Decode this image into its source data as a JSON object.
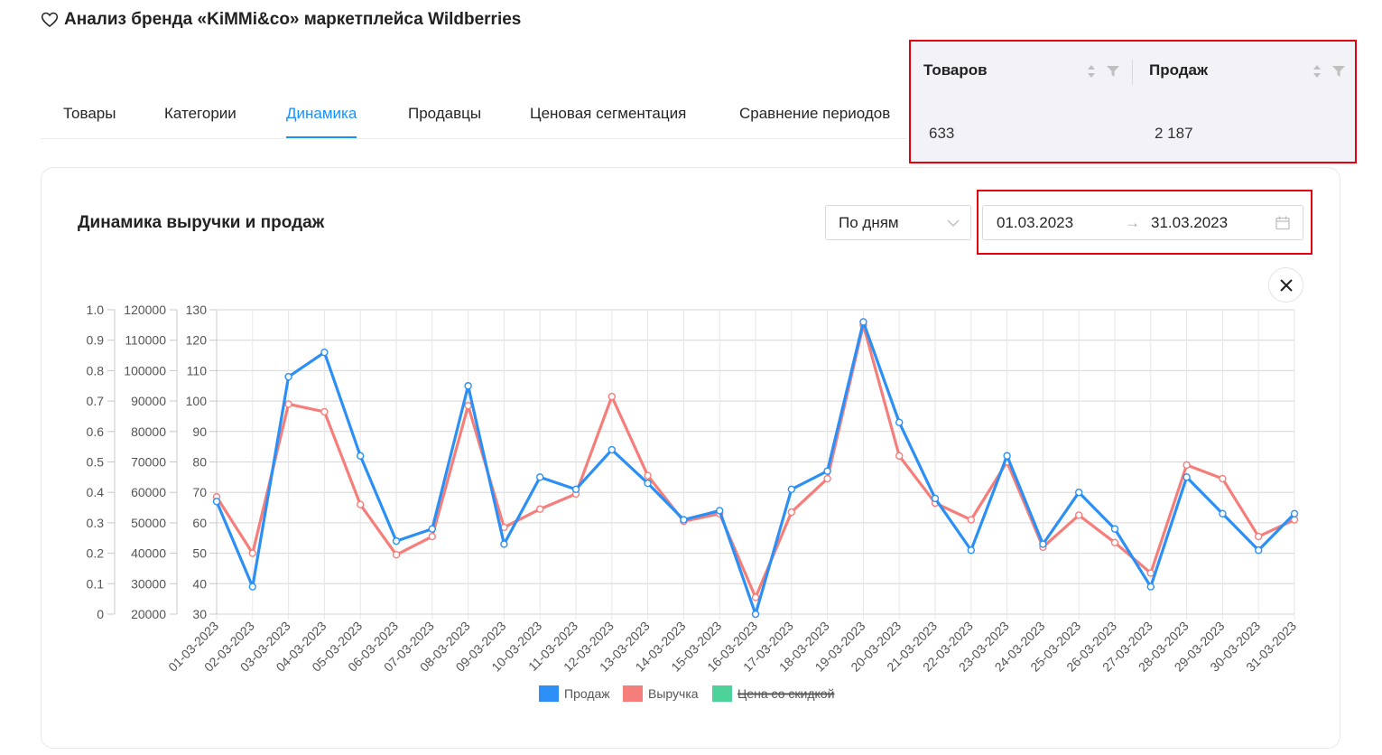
{
  "header": {
    "title": "Анализ бренда «KiMMi&co» маркетплейса Wildberries"
  },
  "tabs": [
    {
      "label": "Товары"
    },
    {
      "label": "Категории"
    },
    {
      "label": "Динамика",
      "active": true
    },
    {
      "label": "Продавцы"
    },
    {
      "label": "Ценовая сегментация"
    },
    {
      "label": "Сравнение периодов"
    }
  ],
  "stats": {
    "columns": [
      {
        "label": "Товаров",
        "value": "633"
      },
      {
        "label": "Продаж",
        "value": "2 187"
      }
    ]
  },
  "card": {
    "title": "Динамика выручки и продаж",
    "period_select": "По дням",
    "date_from": "01.03.2023",
    "date_to": "31.03.2023"
  },
  "colors": {
    "accent": "#1890ff",
    "sales": "#2b8ff5",
    "revenue": "#f67e7a",
    "discount_price": "#4dd39a"
  },
  "chart_data": {
    "type": "line",
    "x": [
      "01-03-2023",
      "02-03-2023",
      "03-03-2023",
      "04-03-2023",
      "05-03-2023",
      "06-03-2023",
      "07-03-2023",
      "08-03-2023",
      "09-03-2023",
      "10-03-2023",
      "11-03-2023",
      "12-03-2023",
      "13-03-2023",
      "14-03-2023",
      "15-03-2023",
      "16-03-2023",
      "17-03-2023",
      "18-03-2023",
      "19-03-2023",
      "20-03-2023",
      "21-03-2023",
      "22-03-2023",
      "23-03-2023",
      "24-03-2023",
      "25-03-2023",
      "26-03-2023",
      "27-03-2023",
      "28-03-2023",
      "29-03-2023",
      "30-03-2023",
      "31-03-2023"
    ],
    "series": [
      {
        "name": "Продаж",
        "axis": "sales",
        "values": [
          67,
          39,
          108,
          116,
          82,
          54,
          58,
          105,
          53,
          75,
          71,
          84,
          73,
          61,
          64,
          30,
          71,
          77,
          126,
          93,
          68,
          51,
          82,
          53,
          70,
          58,
          39,
          75,
          63,
          51,
          63
        ]
      },
      {
        "name": "Выручка",
        "axis": "revenue",
        "values": [
          58500,
          40000,
          89000,
          86500,
          56000,
          39500,
          45500,
          88500,
          48500,
          54500,
          59500,
          91500,
          65500,
          50500,
          53000,
          25500,
          53500,
          64500,
          115000,
          72000,
          56500,
          51000,
          70000,
          42000,
          52500,
          43500,
          33500,
          69000,
          64500,
          45500,
          51000
        ]
      },
      {
        "name": "Цена со скидкой",
        "axis": "discount",
        "hidden": true,
        "values": []
      }
    ],
    "axes": {
      "discount": {
        "min": 0,
        "max": 1.0,
        "ticks": [
          "0",
          "0.1",
          "0.2",
          "0.3",
          "0.4",
          "0.5",
          "0.6",
          "0.7",
          "0.8",
          "0.9",
          "1.0"
        ]
      },
      "revenue": {
        "min": 20000,
        "max": 120000,
        "ticks": [
          "20000",
          "30000",
          "40000",
          "50000",
          "60000",
          "70000",
          "80000",
          "90000",
          "100000",
          "110000",
          "120000"
        ]
      },
      "sales": {
        "min": 30,
        "max": 130,
        "ticks": [
          "30",
          "40",
          "50",
          "60",
          "70",
          "80",
          "90",
          "100",
          "110",
          "120",
          "130"
        ]
      }
    },
    "grid": true,
    "legend": "bottom"
  }
}
